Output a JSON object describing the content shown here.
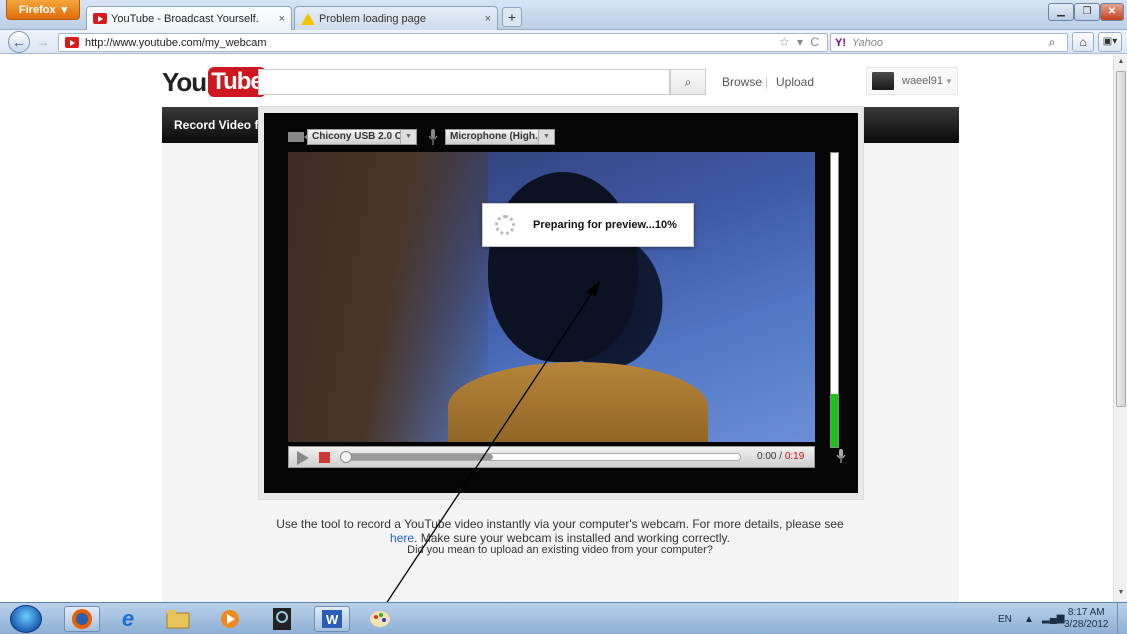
{
  "browser": {
    "menu_label": "Firefox",
    "tabs": [
      {
        "label": "YouTube - Broadcast Yourself.",
        "close": "×"
      },
      {
        "label": "Problem loading page",
        "close": "×"
      }
    ],
    "new_tab": "+",
    "url": "http://www.youtube.com/my_webcam",
    "search_engine": "Y!",
    "search_placeholder": "Yahoo"
  },
  "page": {
    "logo_you": "You",
    "logo_tube": "Tube",
    "nav": {
      "browse": "Browse",
      "separator": "|",
      "upload": "Upload"
    },
    "user": {
      "name": "waeel91"
    },
    "header_title": "Record Video from Webcam",
    "recorder": {
      "camera_select": "Chicony USB 2.0 C..",
      "mic_select": "Microphone (High..",
      "status": "Preparing for preview...10%",
      "progress_percent": 10,
      "mic_level": 0.18,
      "time_current": "0:00",
      "time_separator": " / ",
      "time_total": "0:19",
      "scrub_buffered": 0.38
    },
    "description": {
      "text1": "Use the tool to record a YouTube video instantly via your computer's webcam. For more details, please see",
      "link": "here",
      "text2": ". Make sure your webcam is installed and working correctly.",
      "text3": "Did you mean to upload an existing video from your computer?"
    }
  },
  "taskbar": {
    "language": "EN",
    "time": "8:17 AM",
    "date": "3/28/2012"
  },
  "colors": {
    "youtube_red": "#cc181e",
    "level_green": "#19c419",
    "link_blue": "#1d62c8"
  }
}
